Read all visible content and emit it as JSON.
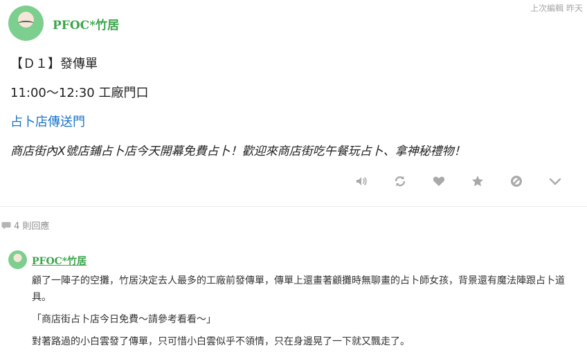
{
  "post": {
    "edited_label": "上次編輯 昨天",
    "author": "PFOC*竹居",
    "lines": [
      "【Ｄ１】發傳單",
      "11:00～12:30 工廠門口",
      "占卜店傳送門",
      "商店街內X號店鋪占卜店今天開幕免費占卜！歡迎來商店街吃午餐玩占卜、拿神秘禮物！"
    ]
  },
  "actions": {
    "icons": [
      "speaker-icon",
      "refresh-icon",
      "heart-icon",
      "star-icon",
      "block-icon",
      "chevron-down-icon"
    ],
    "color": "#a9a9a9"
  },
  "replies": {
    "count_label": "4 則回應",
    "items": [
      {
        "author": "PFOC*竹居",
        "paragraphs": [
          "顧了一陣子的空攤，竹居決定去人最多的工廠前發傳單，傳單上還畫著顧攤時無聊畫的占卜師女孩，背景還有魔法陣跟占卜道具。",
          "「商店街占卜店今日免費～請參考看看～」",
          "對著路過的小白雲發了傳單，只可惜小白雲似乎不領情，只在身邊晃了一下就又飄走了。"
        ]
      }
    ]
  },
  "colors": {
    "author": "#3aa54a",
    "link": "#1a73c9",
    "muted": "#a7a7a7"
  }
}
